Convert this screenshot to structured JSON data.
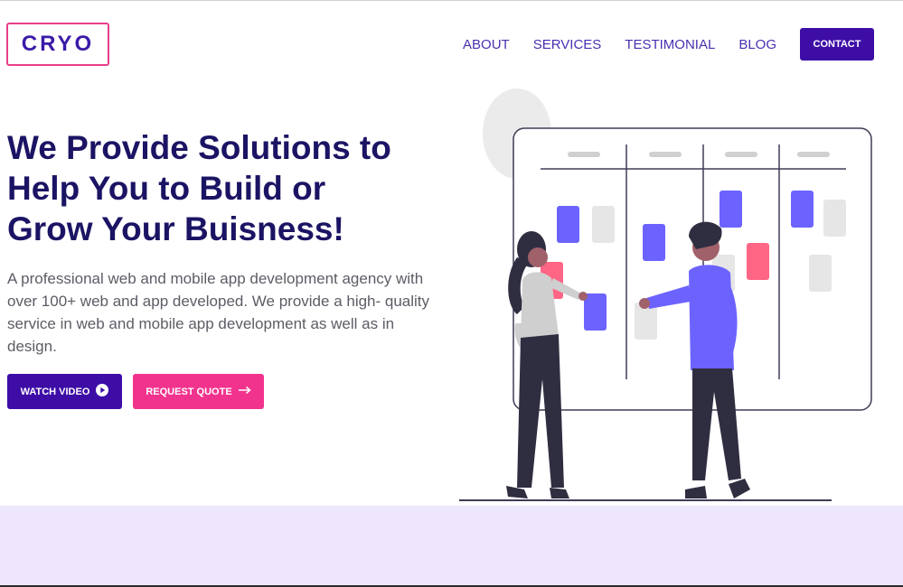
{
  "brand": {
    "logo_text": "CRYO"
  },
  "nav": {
    "items": [
      {
        "label": "ABOUT"
      },
      {
        "label": "SERVICES"
      },
      {
        "label": "TESTIMONIAL"
      },
      {
        "label": "BLOG"
      }
    ],
    "contact_label": "CONTACT"
  },
  "hero": {
    "title_line1": "We Provide Solutions to",
    "title_line2": "Help You to Build or",
    "title_line3": "Grow Your Buisness!",
    "description": "A professional web and mobile app development agency with over 100+ web and app developed. We provide a high- quality service in web and mobile app development as well as in design.",
    "watch_label": "WATCH VIDEO",
    "quote_label": "REQUEST QUOTE"
  },
  "colors": {
    "primary": "#3d0da6",
    "accent": "#f2338d",
    "heading": "#1b1464",
    "band": "#eee6fd"
  },
  "icons": {
    "watch": "play-circle-icon",
    "quote": "arrow-right-icon"
  }
}
